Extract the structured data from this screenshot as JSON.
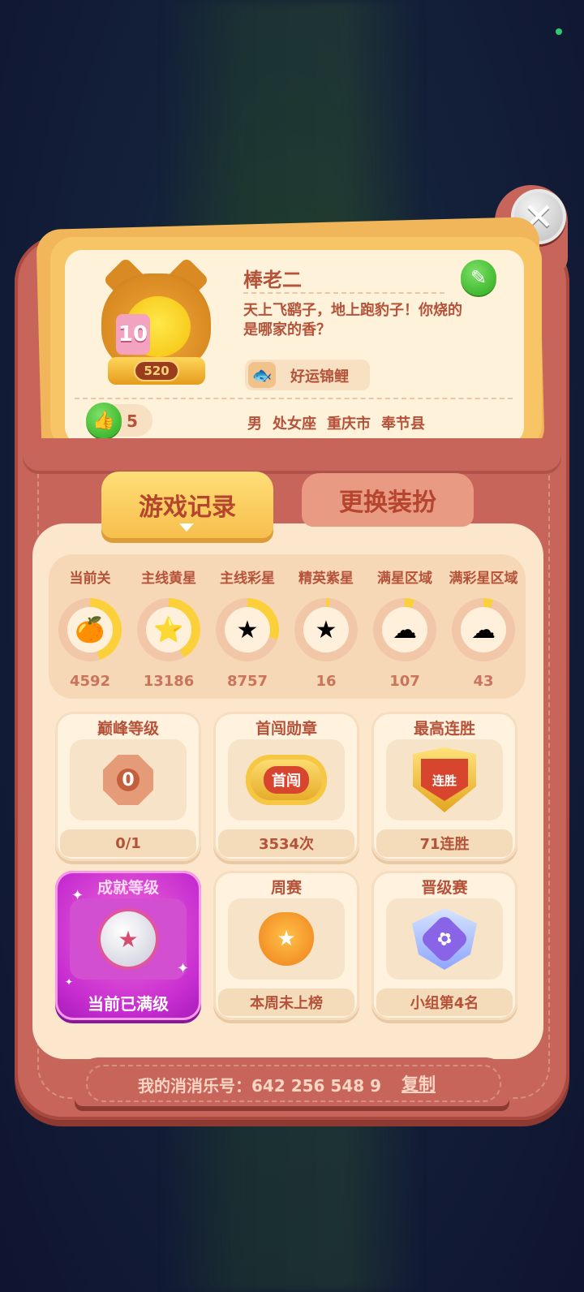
{
  "colors": {
    "frame": "#c7655a",
    "card": "#f7c565",
    "panel": "#fde7cc",
    "text": "#b5523a",
    "accent_green": "#39b528",
    "achievement_pink": "#c72dd0"
  },
  "close": {
    "icon": "close-icon",
    "glyph": "✕"
  },
  "profile": {
    "nickname": "棒老二",
    "signature": "天上飞鹞子，地上跑豹子！你烧的是哪家的香？",
    "title_badge": "好运锦鲤",
    "avatar_badge": "520",
    "avatar_cake_number": "10",
    "likes": "5",
    "gender": "男",
    "zodiac": "处女座",
    "city": "重庆市",
    "county": "奉节县",
    "edit_icon": "pencil-icon",
    "edit_glyph": "✎",
    "like_glyph": "👍",
    "fish_glyph": "🐟"
  },
  "tabs": [
    {
      "label": "游戏记录",
      "active": true
    },
    {
      "label": "更换装扮",
      "active": false
    }
  ],
  "stats": [
    {
      "label": "当前关",
      "value": "4592",
      "icon": "fruit-icon",
      "glyph": "🍊",
      "progress": 0.45,
      "color": "#fcd03b"
    },
    {
      "label": "主线黄星",
      "value": "13186",
      "icon": "yellow-star-icon",
      "glyph": "⭐",
      "progress": 0.42,
      "color": "#fcd03b"
    },
    {
      "label": "主线彩星",
      "value": "8757",
      "icon": "rainbow-star-icon",
      "glyph": "★",
      "progress": 0.3,
      "color": "#fcd03b"
    },
    {
      "label": "精英紫星",
      "value": "16",
      "icon": "purple-star-icon",
      "glyph": "★",
      "progress": 0.02,
      "color": "#fcd03b"
    },
    {
      "label": "满星区域",
      "value": "107",
      "icon": "cloud-star-icon",
      "glyph": "☁",
      "progress": 0.05,
      "color": "#fcd03b"
    },
    {
      "label": "满彩星区域",
      "value": "43",
      "icon": "cloud-rainbow-icon",
      "glyph": "☁",
      "progress": 0.05,
      "color": "#fcd03b"
    }
  ],
  "achievements": [
    {
      "title": "巅峰等级",
      "value": "0/1",
      "icon": "peak-level-icon",
      "emblem": "0"
    },
    {
      "title": "首闯勋章",
      "value": "3534次",
      "icon": "first-clear-medal-icon",
      "emblem": "首闯"
    },
    {
      "title": "最高连胜",
      "value": "71连胜",
      "icon": "win-streak-shield-icon",
      "emblem": "连胜"
    },
    {
      "title": "成就等级",
      "value": "当前已满级",
      "icon": "achievement-medal-icon",
      "emblem": "★"
    },
    {
      "title": "周赛",
      "value": "本周未上榜",
      "icon": "weekly-cat-badge-icon",
      "emblem": "★"
    },
    {
      "title": "晋级赛",
      "value": "小组第4名",
      "icon": "promotion-shield-icon",
      "emblem": "✿"
    }
  ],
  "footer": {
    "uid_text": "我的消消乐号：642 256 548 9",
    "copy_label": "复制"
  }
}
